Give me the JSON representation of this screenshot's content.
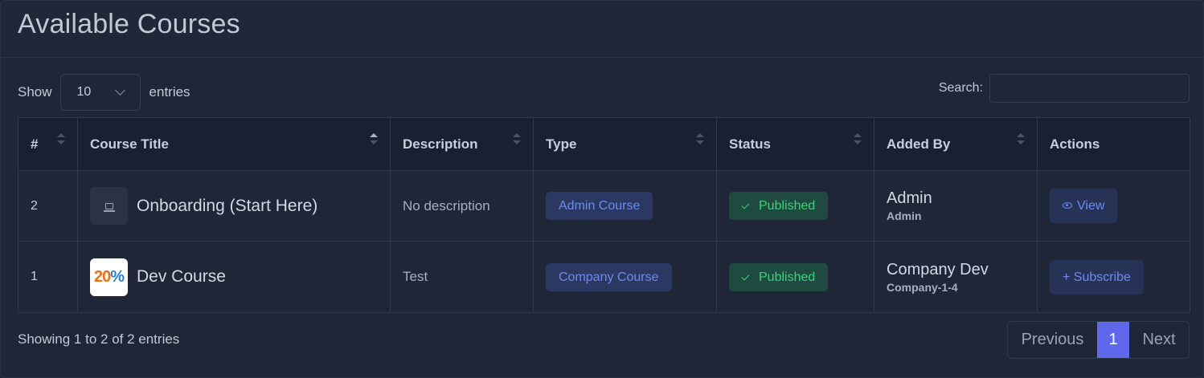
{
  "page": {
    "title": "Available Courses"
  },
  "controls": {
    "show_label": "Show",
    "entries_value": "10",
    "entries_label": "entries",
    "search_label": "Search:",
    "search_value": ""
  },
  "table": {
    "headers": [
      "#",
      "Course Title",
      "Description",
      "Type",
      "Status",
      "Added By",
      "Actions"
    ],
    "rows": [
      {
        "num": "2",
        "title": "Onboarding (Start Here)",
        "thumbnail_icon": "laptop-icon",
        "description": "No description",
        "type": "Admin Course",
        "status": "Published",
        "added_by_name": "Admin",
        "added_by_sub": "Admin",
        "action": "View",
        "action_icon": "eye-icon"
      },
      {
        "num": "1",
        "title": "Dev Course",
        "thumbnail_icon": "promo-image",
        "thumbnail_text": "20%",
        "description": "Test",
        "type": "Company Course",
        "status": "Published",
        "added_by_name": "Company Dev",
        "added_by_sub": "Company-1-4",
        "action": "+ Subscribe",
        "action_icon": "plus-icon"
      }
    ]
  },
  "footer": {
    "info": "Showing 1 to 2 of 2 entries",
    "prev": "Previous",
    "current_page": "1",
    "next": "Next"
  },
  "colors": {
    "background": "#1e2638",
    "accent": "#5f68ea",
    "type_badge": "#2b3862",
    "status_badge": "#1f4a3f",
    "status_text": "#3fd07d"
  }
}
